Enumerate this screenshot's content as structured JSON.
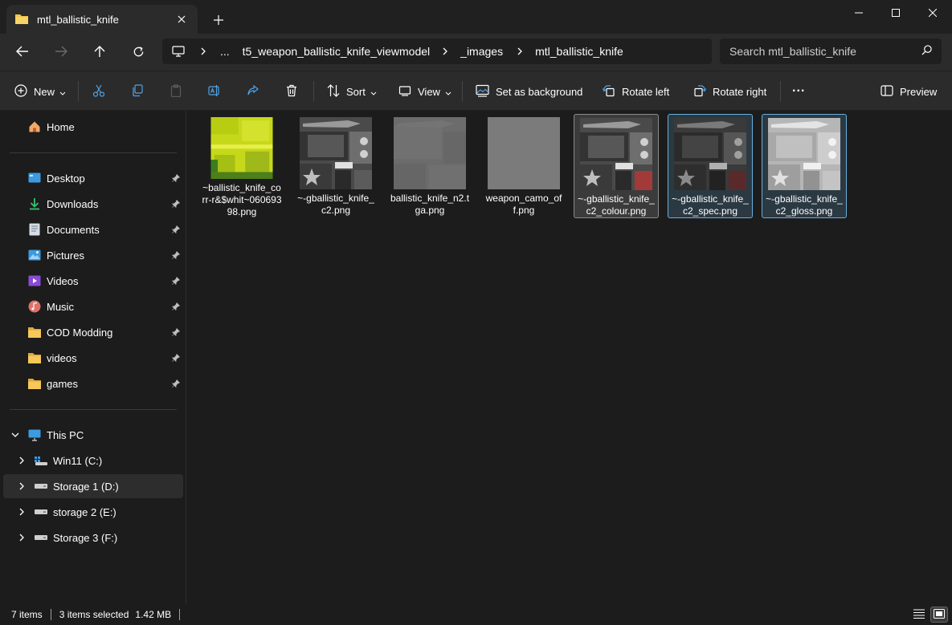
{
  "window": {
    "tab_title": "mtl_ballistic_knife"
  },
  "address": {
    "segments": [
      "...",
      "t5_weapon_ballistic_knife_viewmodel",
      "_images",
      "mtl_ballistic_knife"
    ],
    "search_placeholder": "Search mtl_ballistic_knife"
  },
  "toolbar": {
    "new_label": "New",
    "sort_label": "Sort",
    "view_label": "View",
    "set_background_label": "Set as background",
    "rotate_left_label": "Rotate left",
    "rotate_right_label": "Rotate right",
    "more_label": "...",
    "preview_label": "Preview"
  },
  "sidebar": {
    "home": "Home",
    "quick_access": [
      {
        "label": "Desktop",
        "icon": "desktop-icon"
      },
      {
        "label": "Downloads",
        "icon": "downloads-icon"
      },
      {
        "label": "Documents",
        "icon": "documents-icon"
      },
      {
        "label": "Pictures",
        "icon": "pictures-icon"
      },
      {
        "label": "Videos",
        "icon": "videos-icon"
      },
      {
        "label": "Music",
        "icon": "music-icon"
      },
      {
        "label": "COD Modding",
        "icon": "folder-icon"
      },
      {
        "label": "videos",
        "icon": "folder-icon"
      },
      {
        "label": "games",
        "icon": "folder-icon"
      }
    ],
    "this_pc": "This PC",
    "drives": [
      {
        "label": "Win11 (C:)",
        "icon": "windows-drive-icon"
      },
      {
        "label": "Storage 1 (D:)",
        "icon": "drive-icon"
      },
      {
        "label": "storage 2 (E:)",
        "icon": "drive-icon"
      },
      {
        "label": "Storage 3 (F:)",
        "icon": "drive-icon"
      }
    ]
  },
  "files": [
    {
      "name": "~ballistic_knife_corr-r&$whit~06069398.png",
      "thumb": "yellow"
    },
    {
      "name": "~-gballistic_knife_c2.png",
      "thumb": "knife-gray"
    },
    {
      "name": "ballistic_knife_n2.tga.png",
      "thumb": "normal-gray"
    },
    {
      "name": "weapon_camo_off.png",
      "thumb": "flat-gray"
    },
    {
      "name": "~-gballistic_knife_c2_colour.png",
      "thumb": "knife-colour"
    },
    {
      "name": "~-gballistic_knife_c2_spec.png",
      "thumb": "knife-dark"
    },
    {
      "name": "~-gballistic_knife_c2_gloss.png",
      "thumb": "knife-light"
    }
  ],
  "status": {
    "item_count": "7 items",
    "selection": "3 items selected",
    "size": "1.42 MB"
  },
  "colors": {
    "selection_blue": "#6ab0de",
    "folder_yellow": "#f4c542"
  }
}
